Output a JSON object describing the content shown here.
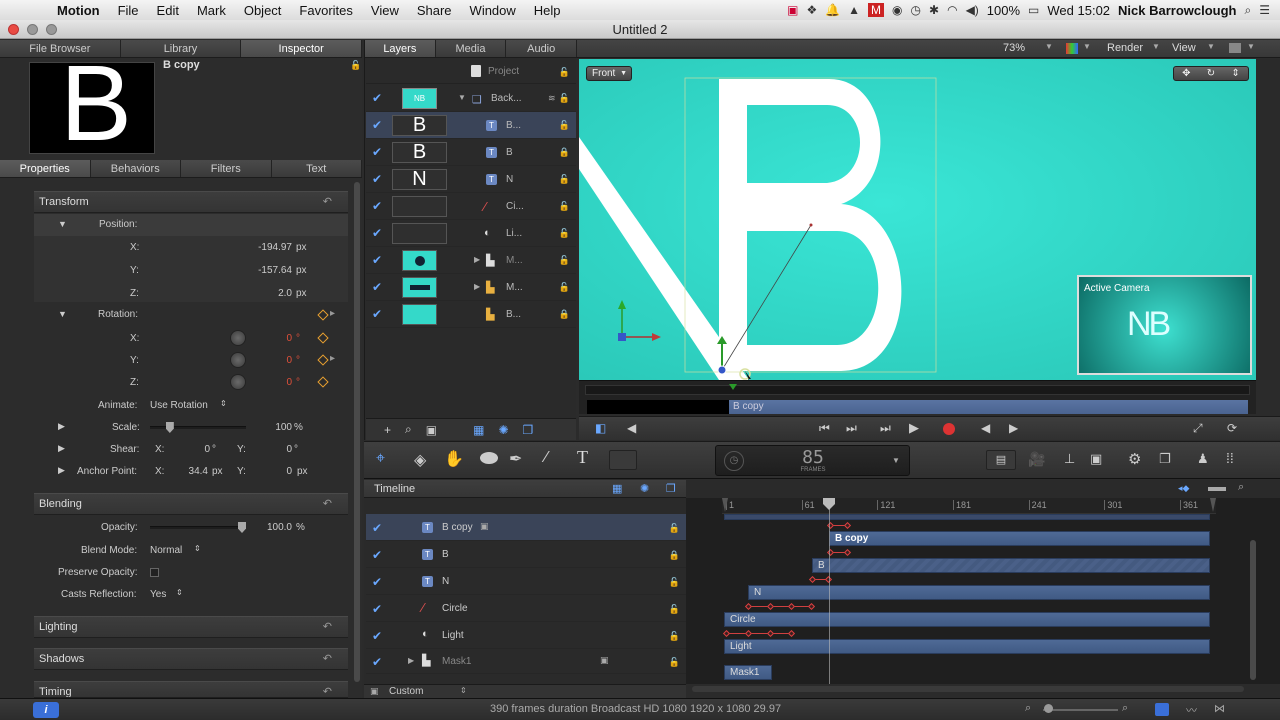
{
  "menubar": {
    "apple": "",
    "app": "Motion",
    "items": [
      "File",
      "Edit",
      "Mark",
      "Object",
      "Favorites",
      "View",
      "Share",
      "Window",
      "Help"
    ],
    "battery": "100%",
    "clock": "Wed 15:02",
    "user": "Nick Barrowclough"
  },
  "window": {
    "title": "Untitled 2"
  },
  "left_tabs": [
    "File Browser",
    "Library",
    "Inspector"
  ],
  "inspector": {
    "object_name": "B copy",
    "preview_letter": "B",
    "subtabs": [
      "Properties",
      "Behaviors",
      "Filters",
      "Text"
    ],
    "transform": {
      "title": "Transform",
      "position_label": "Position:",
      "x_label": "X:",
      "x_val": "-194.97",
      "x_unit": "px",
      "y_label": "Y:",
      "y_val": "-157.64",
      "y_unit": "px",
      "z_label": "Z:",
      "z_val": "2.0",
      "z_unit": "px",
      "rotation_label": "Rotation:",
      "rx_label": "X:",
      "rx_val": "0",
      "ry_label": "Y:",
      "ry_val": "0",
      "rz_label": "Z:",
      "rz_val": "0",
      "deg": "°",
      "animate_label": "Animate:",
      "animate_val": "Use Rotation",
      "scale_label": "Scale:",
      "scale_val": "100",
      "scale_unit": "%",
      "scale_level_percent": 18,
      "shear_label": "Shear:",
      "shear_x_label": "X:",
      "shear_x_val": "0",
      "shear_y_label": "Y:",
      "shear_y_val": "0",
      "anchor_label": "Anchor Point:",
      "anchor_x_label": "X:",
      "anchor_x_val": "34.4",
      "anchor_y_label": "Y:",
      "anchor_y_val": "0",
      "anchor_unit": "px"
    },
    "blending": {
      "title": "Blending",
      "opacity_label": "Opacity:",
      "opacity_val": "100.0",
      "opacity_unit": "%",
      "opacity_level_percent": 100,
      "blend_label": "Blend Mode:",
      "blend_val": "Normal",
      "preserve_label": "Preserve Opacity:",
      "casts_label": "Casts Reflection:",
      "casts_val": "Yes"
    },
    "sections": [
      "Lighting",
      "Shadows",
      "Timing"
    ]
  },
  "layers_tabs": [
    "Layers",
    "Media",
    "Audio"
  ],
  "layers": {
    "project_label": "Project",
    "rows": [
      {
        "name": "Back...",
        "thumb": "NB",
        "icon": "group"
      },
      {
        "name": "B...",
        "thumb": "B",
        "icon": "text"
      },
      {
        "name": "B",
        "thumb": "B",
        "icon": "text"
      },
      {
        "name": "N",
        "thumb": "N",
        "icon": "text"
      },
      {
        "name": "Ci...",
        "thumb": "",
        "icon": "shape"
      },
      {
        "name": "Li...",
        "thumb": "",
        "icon": "light"
      },
      {
        "name": "M...",
        "thumb": "",
        "icon": "mask"
      },
      {
        "name": "M...",
        "thumb": "",
        "icon": "mask"
      },
      {
        "name": "B...",
        "thumb": "",
        "icon": "mask"
      }
    ]
  },
  "canvas": {
    "zoom": "73%",
    "render": "Render",
    "view": "View",
    "camera_menu": "Front",
    "active_camera_label": "Active Camera",
    "active_camera_text": "NB",
    "mini_bar_label": "B copy",
    "big_letter": "B",
    "bg_color": "#34d9c9"
  },
  "timecode": {
    "value": "85",
    "unit": "FRAMES"
  },
  "timeline": {
    "title": "Timeline",
    "ruler": [
      "1",
      "61",
      "121",
      "181",
      "241",
      "301",
      "361"
    ],
    "rows": [
      {
        "name": "B copy"
      },
      {
        "name": "B"
      },
      {
        "name": "N"
      },
      {
        "name": "Circle"
      },
      {
        "name": "Light"
      },
      {
        "name": "Mask1"
      }
    ],
    "bars": [
      "B copy",
      "B",
      "N",
      "Circle",
      "Light",
      "Mask1"
    ],
    "custom": "Custom"
  },
  "status": {
    "text": "390 frames duration Broadcast HD 1080 1920 x 1080 29.97"
  }
}
